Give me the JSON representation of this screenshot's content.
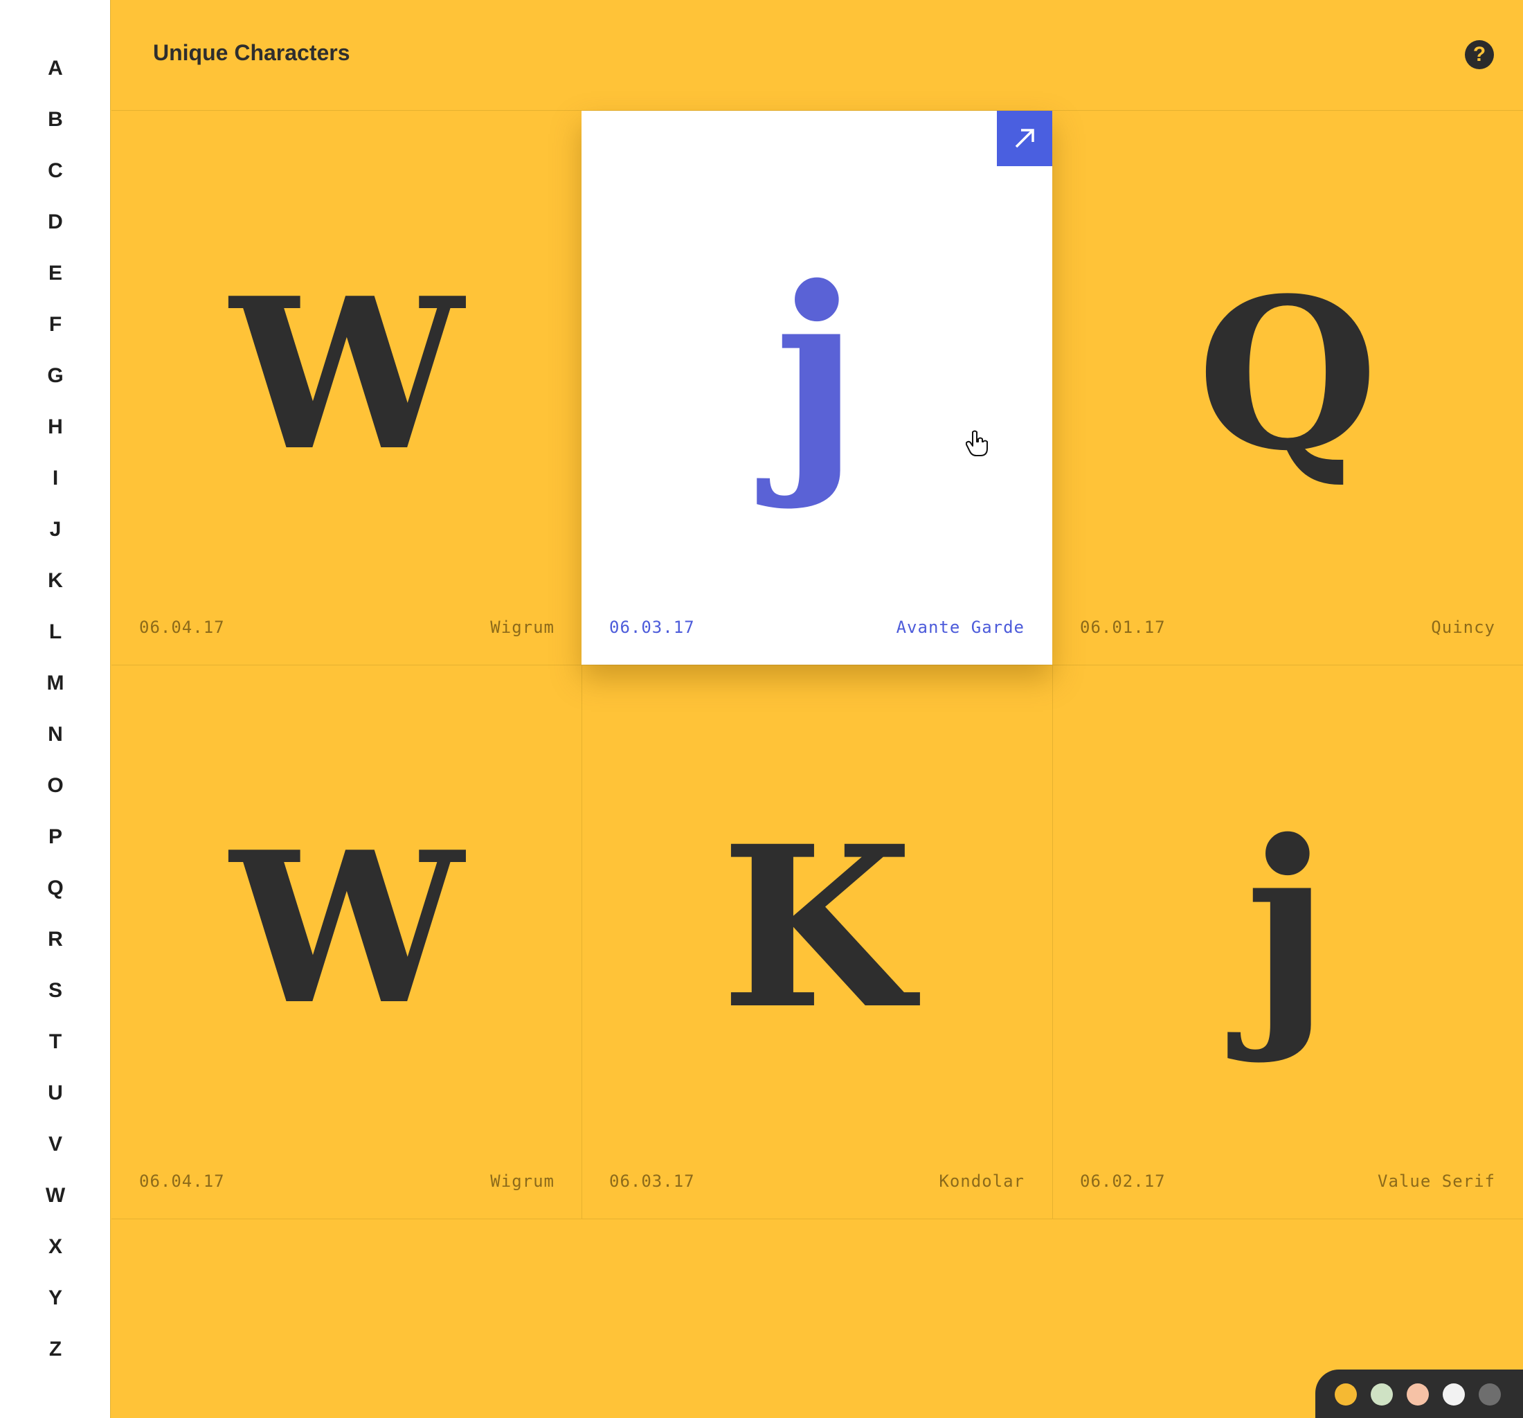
{
  "sidebar": {
    "letters": [
      "A",
      "B",
      "C",
      "D",
      "E",
      "F",
      "G",
      "H",
      "I",
      "J",
      "K",
      "L",
      "M",
      "N",
      "O",
      "P",
      "Q",
      "R",
      "S",
      "T",
      "U",
      "V",
      "W",
      "X",
      "Y",
      "Z"
    ]
  },
  "header": {
    "title": "Unique Characters",
    "help_label": "?"
  },
  "cards": [
    {
      "glyph": "W",
      "date": "06.04.17",
      "font": "Wigrum",
      "active": false
    },
    {
      "glyph": "j",
      "date": "06.03.17",
      "font": "Avante Garde",
      "active": true
    },
    {
      "glyph": "Q",
      "date": "06.01.17",
      "font": "Quincy",
      "active": false
    },
    {
      "glyph": "W",
      "date": "06.04.17",
      "font": "Wigrum",
      "active": false
    },
    {
      "glyph": "K",
      "date": "06.03.17",
      "font": "Kondolar",
      "active": false
    },
    {
      "glyph": "j",
      "date": "06.02.17",
      "font": "Value Serif",
      "active": false
    }
  ],
  "palette": {
    "swatches": [
      "#F5B933",
      "#CFE2C4",
      "#F6C2A6",
      "#F2F2F2",
      "#6E6E6E"
    ]
  },
  "colors": {
    "background": "#FFC338",
    "accent": "#4A5FE0",
    "ink": "#2E2E2E"
  },
  "icons": {
    "open": "arrow-up-right-icon",
    "help": "question-circle-icon",
    "cursor": "hand-pointer-icon"
  }
}
